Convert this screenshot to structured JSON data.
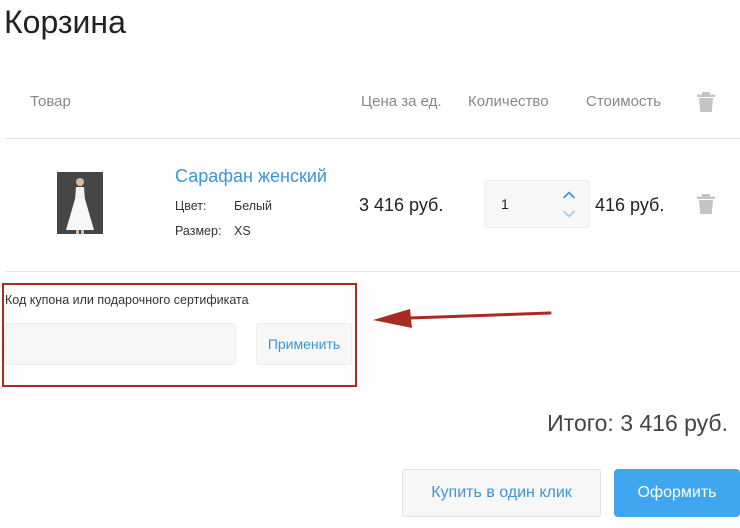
{
  "page": {
    "title": "Корзина"
  },
  "table": {
    "headers": {
      "product": "Товар",
      "unit_price": "Цена за ед.",
      "quantity": "Количество",
      "cost": "Стоимость"
    }
  },
  "cart_item": {
    "name": "Сарафан женский",
    "attributes": {
      "color_label": "Цвет:",
      "color_value": "Белый",
      "size_label": "Размер:",
      "size_value": "XS"
    },
    "unit_price": "3 416 руб.",
    "quantity": "1",
    "line_total": "416 руб."
  },
  "coupon": {
    "label": "Код купона или подарочного сертификата",
    "input_value": "",
    "apply_label": "Применить"
  },
  "summary": {
    "total": "Итого: 3 416 руб."
  },
  "actions": {
    "one_click_label": "Купить в один клик",
    "checkout_label": "Оформить"
  },
  "icons": {
    "trash": "trash-icon",
    "up": "chevron-up-icon",
    "down": "chevron-down-icon",
    "arrow": "arrow-left-icon"
  },
  "colors": {
    "accent": "#3a96d6",
    "checkout_bg": "#41a6f0",
    "highlight": "#a92c24"
  }
}
